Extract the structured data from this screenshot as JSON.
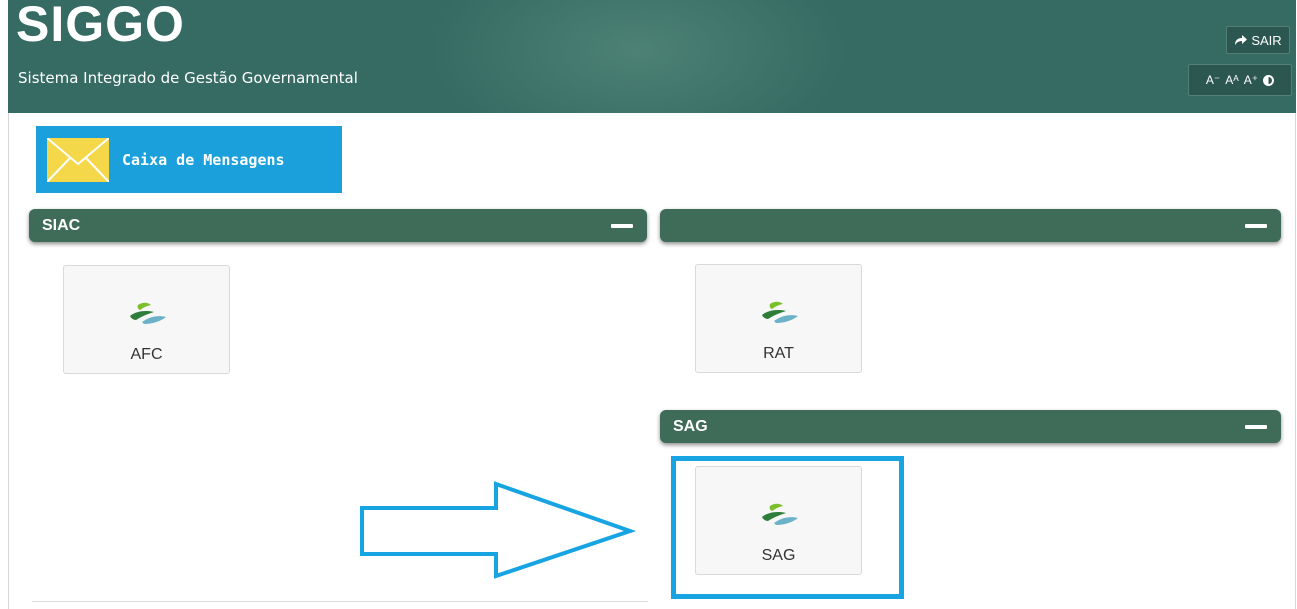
{
  "header": {
    "title": "SIGGO",
    "subtitle": "Sistema Integrado de Gestão Governamental",
    "logout_label": "SAIR",
    "font_controls": {
      "decrease": "A⁻",
      "normal": "Aᴬ",
      "increase": "A⁺"
    }
  },
  "messages": {
    "label": "Caixa de Mensagens"
  },
  "panels": [
    {
      "title": "SIAC",
      "apps": [
        "AFC"
      ]
    },
    {
      "title": "",
      "apps": [
        "RAT"
      ]
    },
    {
      "title": "SAG",
      "apps": [
        "SAG"
      ]
    }
  ],
  "colors": {
    "header": "#356b63",
    "panel_bar": "#3f6c59",
    "message_button": "#1ba0dc",
    "highlight": "#17a4e3"
  }
}
